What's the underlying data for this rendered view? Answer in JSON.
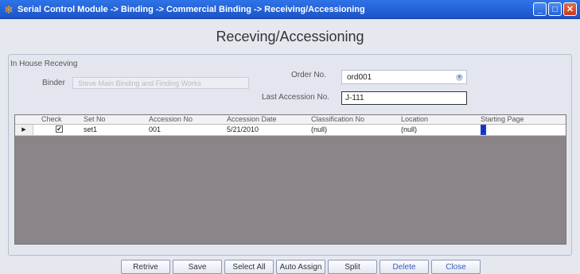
{
  "window": {
    "title": "Serial Control Module -> Binding -> Commercial Binding -> Receiving/Accessioning",
    "app_icon": "snowflake-icon",
    "controls": {
      "minimize": "_",
      "maximize": "□",
      "close": "✕"
    }
  },
  "page": {
    "heading": "Receving/Accessioning"
  },
  "form": {
    "group_label": "In House Receving",
    "binder_label": "Binder",
    "binder_value": "Steve Main Binding and Finding Works",
    "order_label": "Order No.",
    "order_value": "ord001",
    "last_accession_label": "Last Accession No.",
    "last_accession_value": "J-111"
  },
  "grid": {
    "columns": [
      "Check",
      "Set No",
      "Accession No",
      "Accession Date",
      "Classification No",
      "Location",
      "Starting Page"
    ],
    "rows": [
      {
        "check": "✔",
        "set_no": "set1",
        "accession_no": "001",
        "accession_date": "5/21/2010",
        "classification_no": "(null)",
        "location": "(null)",
        "starting_page": "1"
      }
    ]
  },
  "buttons": {
    "retrive": "Retrive",
    "save": "Save",
    "select_all": "Select All",
    "auto_assign": "Auto Assign",
    "split": "Split",
    "delete": "Delete",
    "close": "Close"
  },
  "colors": {
    "titlebar": "#1c54c9",
    "grid_bg": "#8b8589",
    "cursor": "#1a3bcc"
  }
}
